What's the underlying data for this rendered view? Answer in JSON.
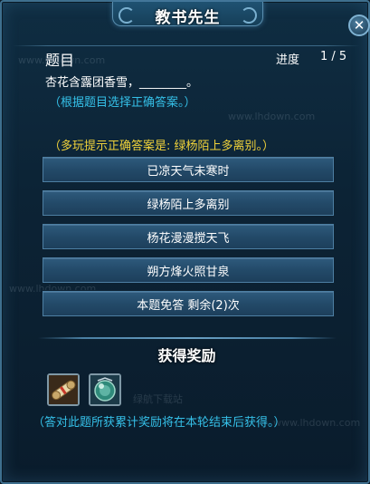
{
  "window": {
    "title": "教书先生",
    "close_symbol": "✕"
  },
  "quiz": {
    "question_label": "题目",
    "progress_label": "进度",
    "progress_value": "1 / 5",
    "question_text": "杏花含露团香雪，________。",
    "instruction": "（根据题目选择正确答案。）",
    "multiplayer_hint": "（多玩提示正确答案是: 绿杨陌上多离别。）",
    "answers": [
      {
        "label": "已凉天气未寒时"
      },
      {
        "label": "绿杨陌上多离别"
      },
      {
        "label": "杨花漫漫搅天飞"
      },
      {
        "label": "朔方烽火照甘泉"
      },
      {
        "label": "本题免答 剩余(2)次"
      }
    ]
  },
  "rewards": {
    "title": "获得奖励",
    "items": [
      {
        "icon": "scroll-icon"
      },
      {
        "icon": "orb-icon"
      }
    ],
    "note": "（答对此题所获累计奖励将在本轮结束后获得。）"
  },
  "watermarks": [
    "www.lhdown.com",
    "www.lhdown.com",
    "www.lhdown.com",
    "www.lhdown.com",
    "绿航下载站",
    "绿航下载站"
  ],
  "colors": {
    "hint_cyan": "#35c0e8",
    "hint_yellow": "#f0d23a",
    "panel_bg": "#0f2d42",
    "button_bg": "#2b5577"
  }
}
